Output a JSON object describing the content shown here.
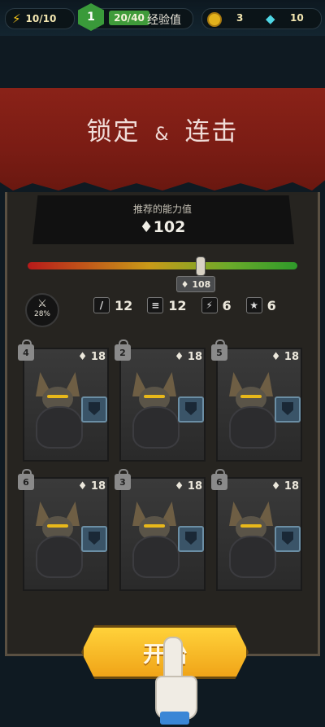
{
  "topbar": {
    "energy": "10/10",
    "level": "1",
    "xp": "20/40",
    "xp_label": "经验值",
    "coins": "3",
    "gems": "10"
  },
  "banner": {
    "title_left": "锁定",
    "amp": "&",
    "title_right": "连击"
  },
  "recommend": {
    "label": "推荐的能力值",
    "value": "♦102",
    "current": "♦ 108",
    "slider_fraction": 0.64
  },
  "stats": {
    "crit": "28%",
    "attack": "12",
    "defense": "12",
    "speed": "6",
    "star": "6"
  },
  "cards": [
    {
      "level": "4",
      "power": "18"
    },
    {
      "level": "2",
      "power": "18"
    },
    {
      "level": "5",
      "power": "18"
    },
    {
      "level": "6",
      "power": "18"
    },
    {
      "level": "3",
      "power": "18"
    },
    {
      "level": "6",
      "power": "18"
    }
  ],
  "start_label": "开始",
  "colors": {
    "accent": "#f0a418",
    "banner": "#7a1c14",
    "xp_green": "#3f9b3a"
  }
}
